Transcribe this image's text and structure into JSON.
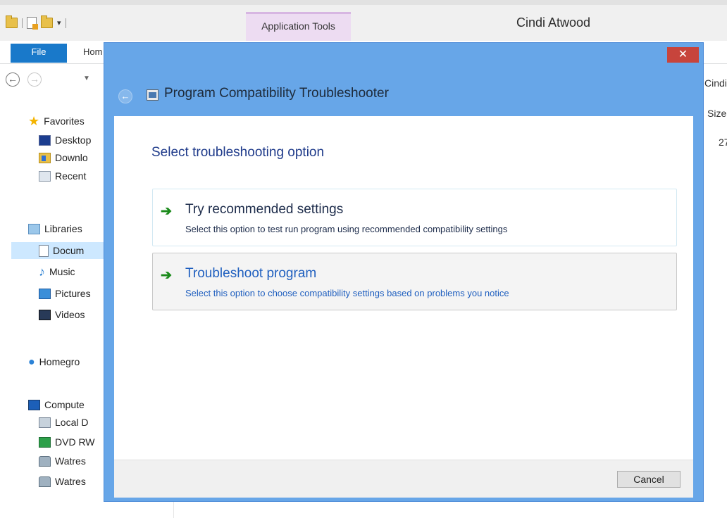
{
  "explorer": {
    "window_title": "Cindi Atwood",
    "context_tab": "Application Tools",
    "tabs": {
      "file": "File",
      "home": "Hom"
    },
    "right_fragments": {
      "address": "Cindi",
      "size_header": "Size",
      "size_value": "27"
    },
    "nav_tree": [
      {
        "label": "Favorites",
        "icon": "star-icon"
      },
      {
        "label": "Desktop",
        "icon": "desktop-icon"
      },
      {
        "label": "Downlo",
        "icon": "downloads-icon"
      },
      {
        "label": "Recent",
        "icon": "recent-places-icon"
      },
      {
        "label": "Libraries",
        "icon": "libraries-icon"
      },
      {
        "label": "Docum",
        "icon": "documents-icon",
        "selected": true
      },
      {
        "label": "Music",
        "icon": "music-icon"
      },
      {
        "label": "Pictures",
        "icon": "pictures-icon"
      },
      {
        "label": "Videos",
        "icon": "videos-icon"
      },
      {
        "label": "Homegro",
        "icon": "homegroup-icon"
      },
      {
        "label": "Compute",
        "icon": "computer-icon"
      },
      {
        "label": "Local D",
        "icon": "local-disk-icon"
      },
      {
        "label": "DVD RW",
        "icon": "dvd-drive-icon"
      },
      {
        "label": "Watres",
        "icon": "network-drive-icon"
      },
      {
        "label": "Watres",
        "icon": "network-drive-icon"
      }
    ]
  },
  "dialog": {
    "title": "Program Compatibility Troubleshooter",
    "close_glyph": "✕",
    "back_glyph": "←",
    "heading": "Select troubleshooting option",
    "options": [
      {
        "title": "Try recommended settings",
        "description": "Select this option to test run program using recommended compatibility settings"
      },
      {
        "title": "Troubleshoot program",
        "description": "Select this option to choose compatibility settings based on problems you notice"
      }
    ],
    "cancel_label": "Cancel",
    "accent_color": "#67a6e8",
    "close_color": "#c7443c"
  }
}
